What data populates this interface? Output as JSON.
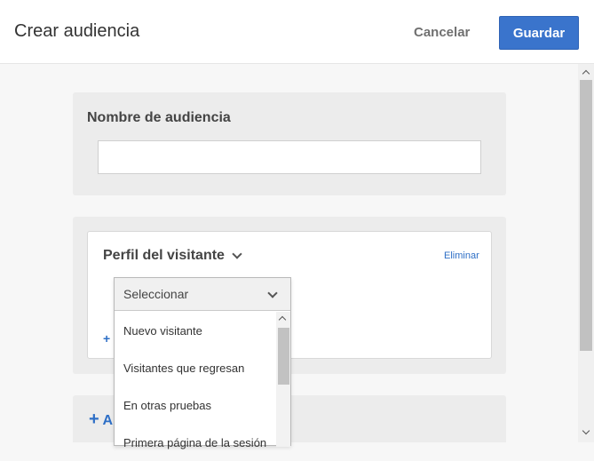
{
  "header": {
    "title": "Crear audiencia",
    "cancel_label": "Cancelar",
    "save_label": "Guardar"
  },
  "audience_name": {
    "label": "Nombre de audiencia",
    "value": ""
  },
  "visitor_profile": {
    "title": "Perfil del visitante",
    "delete_label": "Eliminar",
    "add_label": "+",
    "select": {
      "selected": "Seleccionar",
      "options": [
        "Nuevo visitante",
        "Visitantes que regresan",
        "En otras pruebas",
        "Primera página de la sesión"
      ]
    }
  },
  "add_section": {
    "plus": "+",
    "label": "A"
  },
  "colors": {
    "primary": "#3a74cc",
    "link": "#2e6fc6",
    "card_bg": "#ececec"
  }
}
